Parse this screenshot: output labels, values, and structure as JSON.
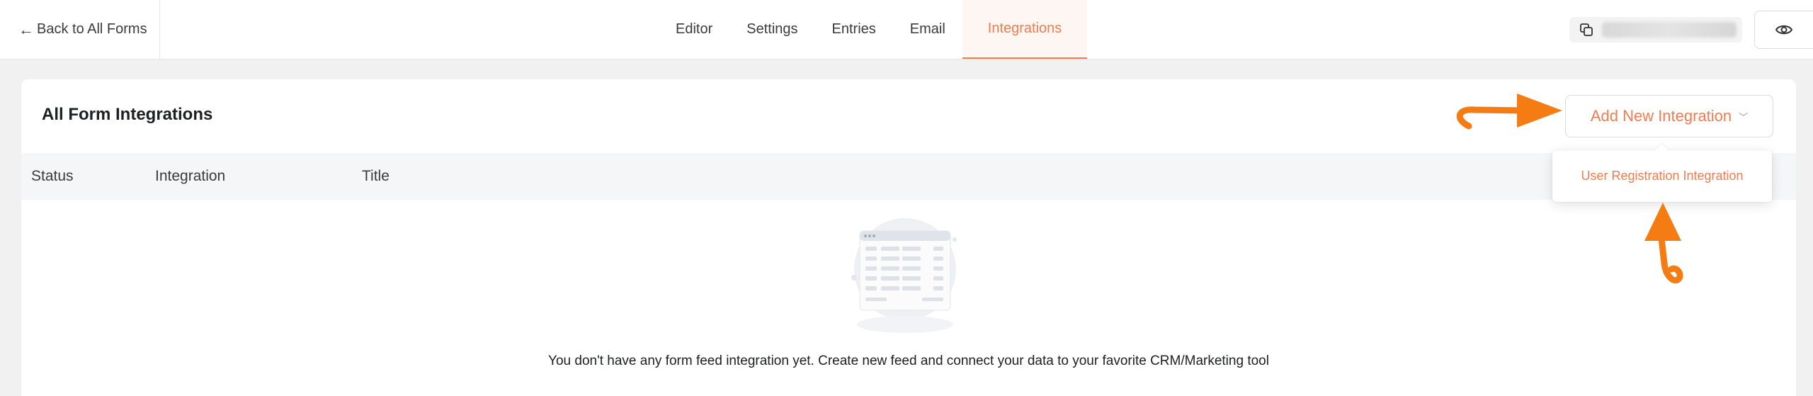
{
  "topbar": {
    "back_label": "Back to All Forms",
    "tabs": [
      {
        "label": "Editor",
        "active": false
      },
      {
        "label": "Settings",
        "active": false
      },
      {
        "label": "Entries",
        "active": false
      },
      {
        "label": "Email",
        "active": false
      },
      {
        "label": "Integrations",
        "active": true
      }
    ],
    "copy_icon": "copy-icon",
    "preview_icon": "eye-icon"
  },
  "card": {
    "title": "All Form Integrations",
    "add_button_label": "Add New Integration",
    "columns": [
      "Status",
      "Integration",
      "Title"
    ],
    "empty_message": "You don't have any form feed integration yet. Create new feed and connect your data to your favorite CRM/Marketing tool"
  },
  "dropdown": {
    "items": [
      "User Registration Integration"
    ]
  },
  "colors": {
    "accent": "#f07d4f",
    "annotation_arrow": "#f57c12",
    "page_background": "#f1f1f1"
  }
}
